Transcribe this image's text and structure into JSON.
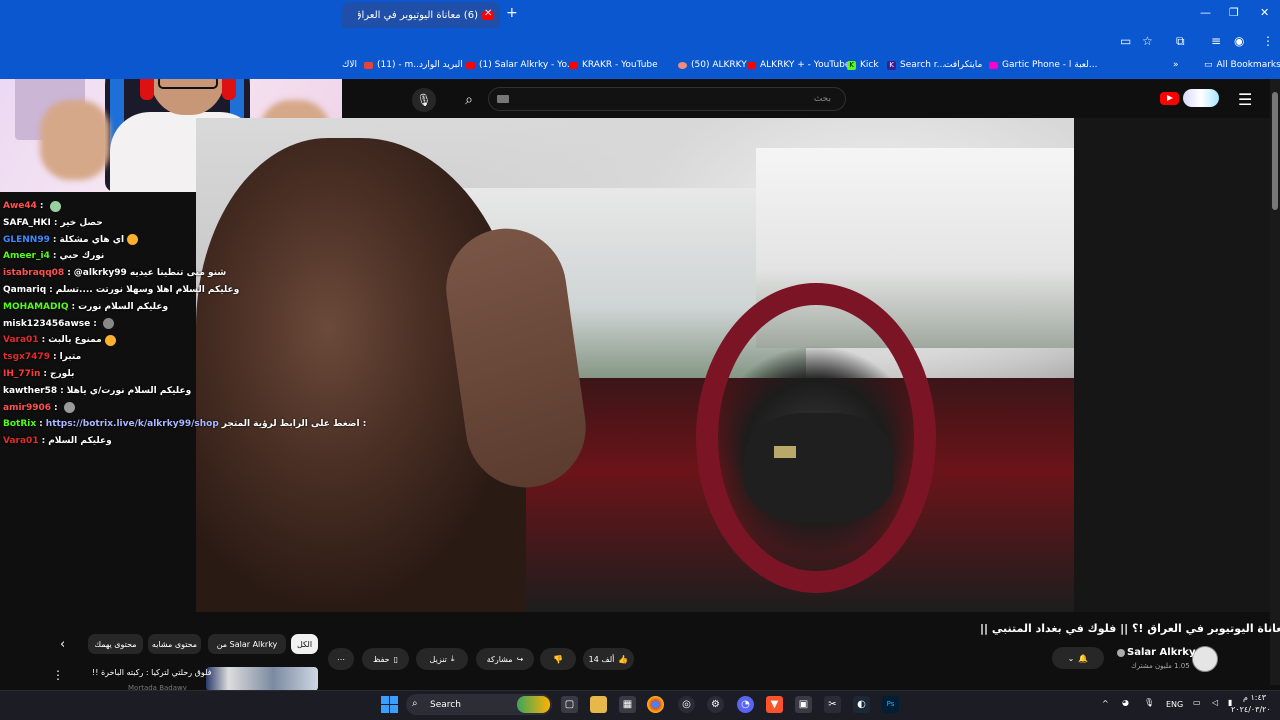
{
  "browser": {
    "tab_title": "(6) معاناة اليوتيوبر في العراق !؟",
    "new_tab": "+",
    "window_controls": [
      "—",
      "❐",
      "✕"
    ],
    "toolbar_icons": [
      "cast-icon",
      "star-icon",
      "extensions-icon",
      "media-icon",
      "profile-icon",
      "more-icon"
    ],
    "bookmarks": [
      {
        "label": "الاك",
        "icon": "folder"
      },
      {
        "label": "(11) - m...",
        "icon": "gmail"
      },
      {
        "label": "البريد الوارد",
        "icon": "mail"
      },
      {
        "label": "(1) Salar Alkrky - Yo...",
        "icon": "youtube"
      },
      {
        "label": "KRAKR - YouTube",
        "icon": "youtube"
      },
      {
        "label": "(50) ALKRKY",
        "icon": "chat"
      },
      {
        "label": "ALKRKY + - YouTube",
        "icon": "youtube"
      },
      {
        "label": "Kick",
        "icon": "kick"
      },
      {
        "label": "Search r...",
        "icon": "k"
      },
      {
        "label": "مايتكرافت",
        "icon": "k"
      },
      {
        "label": "Gartic Phone - لعبة ا...",
        "icon": "gartic"
      }
    ],
    "bookmarks_overflow": "»",
    "all_bookmarks": "All Bookmarks"
  },
  "youtube": {
    "search_placeholder": "بحث",
    "logo": "youtube-logo",
    "menu_icon": "☰"
  },
  "chat": [
    {
      "name": "Awe44",
      "name_color": "#ff5151",
      "msg": "",
      "emote": "#9ad0a0"
    },
    {
      "name": "SAFA_HKI",
      "name_color": "#ffffff",
      "msg": "حصل خير",
      "emote": ""
    },
    {
      "name": "GLENN99",
      "name_color": "#3b8bff",
      "msg": "اي هاي مشكلة",
      "emote": "#ffb02e"
    },
    {
      "name": "Ameer_i4",
      "name_color": "#53fc18",
      "msg": "نورك حبي",
      "emote": ""
    },
    {
      "name": "istabraqq08",
      "name_color": "#ff5151",
      "msg": "@alkrky99 شنو متى تنطينا عيديه",
      "emote": ""
    },
    {
      "name": "Qamariq",
      "name_color": "#ffffff",
      "msg": "وعليكم السلام اهلا وسهلا نورتت ....تسلم",
      "emote": ""
    },
    {
      "name": "MOHAMADIQ",
      "name_color": "#53fc18",
      "msg": "وعليكم السلام نورت",
      "emote": ""
    },
    {
      "name": "misk123456awse",
      "name_color": "#ffffff",
      "msg": "",
      "emote": "#888888"
    },
    {
      "name": "Vara01",
      "name_color": "#e22b2b",
      "msg": "ممنوع بالبث",
      "emote": "#ffb02e"
    },
    {
      "name": "tsgx7479",
      "name_color": "#e22b2b",
      "msg": "متبرا",
      "emote": ""
    },
    {
      "name": "IH_77in",
      "name_color": "#ff3b3b",
      "msg": "بلورج",
      "emote": ""
    },
    {
      "name": "kawther58",
      "name_color": "#ffffff",
      "msg": "وعليكم السلام نورت/ي ياهلا",
      "emote": ""
    },
    {
      "name": "amir9906",
      "name_color": "#ff5151",
      "msg": "",
      "emote": "#9a9a9a"
    },
    {
      "name": "BotRix",
      "name_color": "#53fc18",
      "msg": "اضغط على الرابط لرؤية المتجر :",
      "link": "https://botrix.live/k/alkrky99/shop",
      "emote": ""
    },
    {
      "name": "Vara01",
      "name_color": "#e22b2b",
      "msg": "وعليكم السلام",
      "emote": ""
    }
  ],
  "video": {
    "title": "معاناة اليوتيوبر في العراق !؟ || فلوك في بغداد المتنبي ||",
    "channel_name": "Salar Alkrky",
    "subscribers": "1.05 مليون مشترك",
    "likes": "14 ألف",
    "share_label": "مشاركة",
    "download_label": "تنزيل",
    "save_label": "حفظ",
    "more": "⋯"
  },
  "recommendations": {
    "chips": [
      "الكل",
      "من Salar Alkrky",
      "محتوى مشابه",
      "محتوى يهمك"
    ],
    "first_title": "فلوق رحلتي لتركيا : ركبته الباخرة !!",
    "first_channel": "Mortada Badawy"
  },
  "taskbar": {
    "search_label": "Search",
    "language": "ENG",
    "time": "١:٤٣ م",
    "date": "٢٠٢٤/٠٣/٢٠"
  }
}
